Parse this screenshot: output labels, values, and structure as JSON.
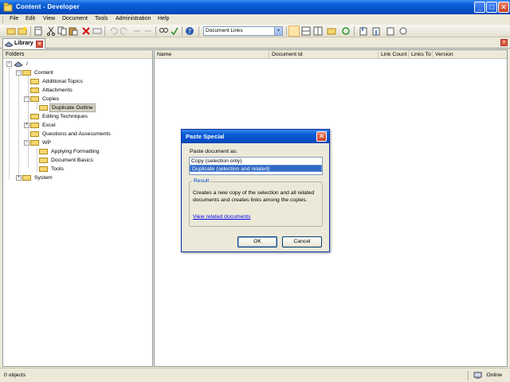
{
  "window": {
    "title": "Content - Developer"
  },
  "menu": [
    {
      "label": "File"
    },
    {
      "label": "Edit"
    },
    {
      "label": "View"
    },
    {
      "label": "Document"
    },
    {
      "label": "Tools"
    },
    {
      "label": "Administration"
    },
    {
      "label": "Help"
    }
  ],
  "toolbar": {
    "view_select_value": "Document Links"
  },
  "tab": {
    "label": "Library"
  },
  "folders": {
    "header": "Folders",
    "root": "/",
    "items": [
      {
        "label": "Content"
      },
      {
        "label": "Additional Topics"
      },
      {
        "label": "Attachments"
      },
      {
        "label": "Copies"
      },
      {
        "label": "Duplicate Outline"
      },
      {
        "label": "Editing Techniques"
      },
      {
        "label": "Excel"
      },
      {
        "label": "Questions and Assessments"
      },
      {
        "label": "WP"
      },
      {
        "label": "Applying Formatting"
      },
      {
        "label": "Document Basics"
      },
      {
        "label": "Tools"
      },
      {
        "label": "System"
      }
    ]
  },
  "doclist": {
    "columns": [
      {
        "label": "Name"
      },
      {
        "label": "Document Id"
      },
      {
        "label": "Link Count"
      },
      {
        "label": "Links To"
      },
      {
        "label": "Version"
      }
    ]
  },
  "status": {
    "left": "0 objects",
    "right": "Online"
  },
  "dialog": {
    "title": "Paste Special",
    "prompt": "Paste document as:",
    "options": [
      {
        "label": "Copy (selection only)",
        "selected": false
      },
      {
        "label": "Duplicate (selection and related)",
        "selected": true
      }
    ],
    "result_legend": "Result",
    "result_text": "Creates a new copy of the selection and all related documents and creates links among the copies.",
    "link": "View related documents",
    "ok": "OK",
    "cancel": "Cancel"
  },
  "colors": {
    "titlebar": "#0a5fd8",
    "selection": "#316ac5",
    "folder": "#f5d76e"
  }
}
